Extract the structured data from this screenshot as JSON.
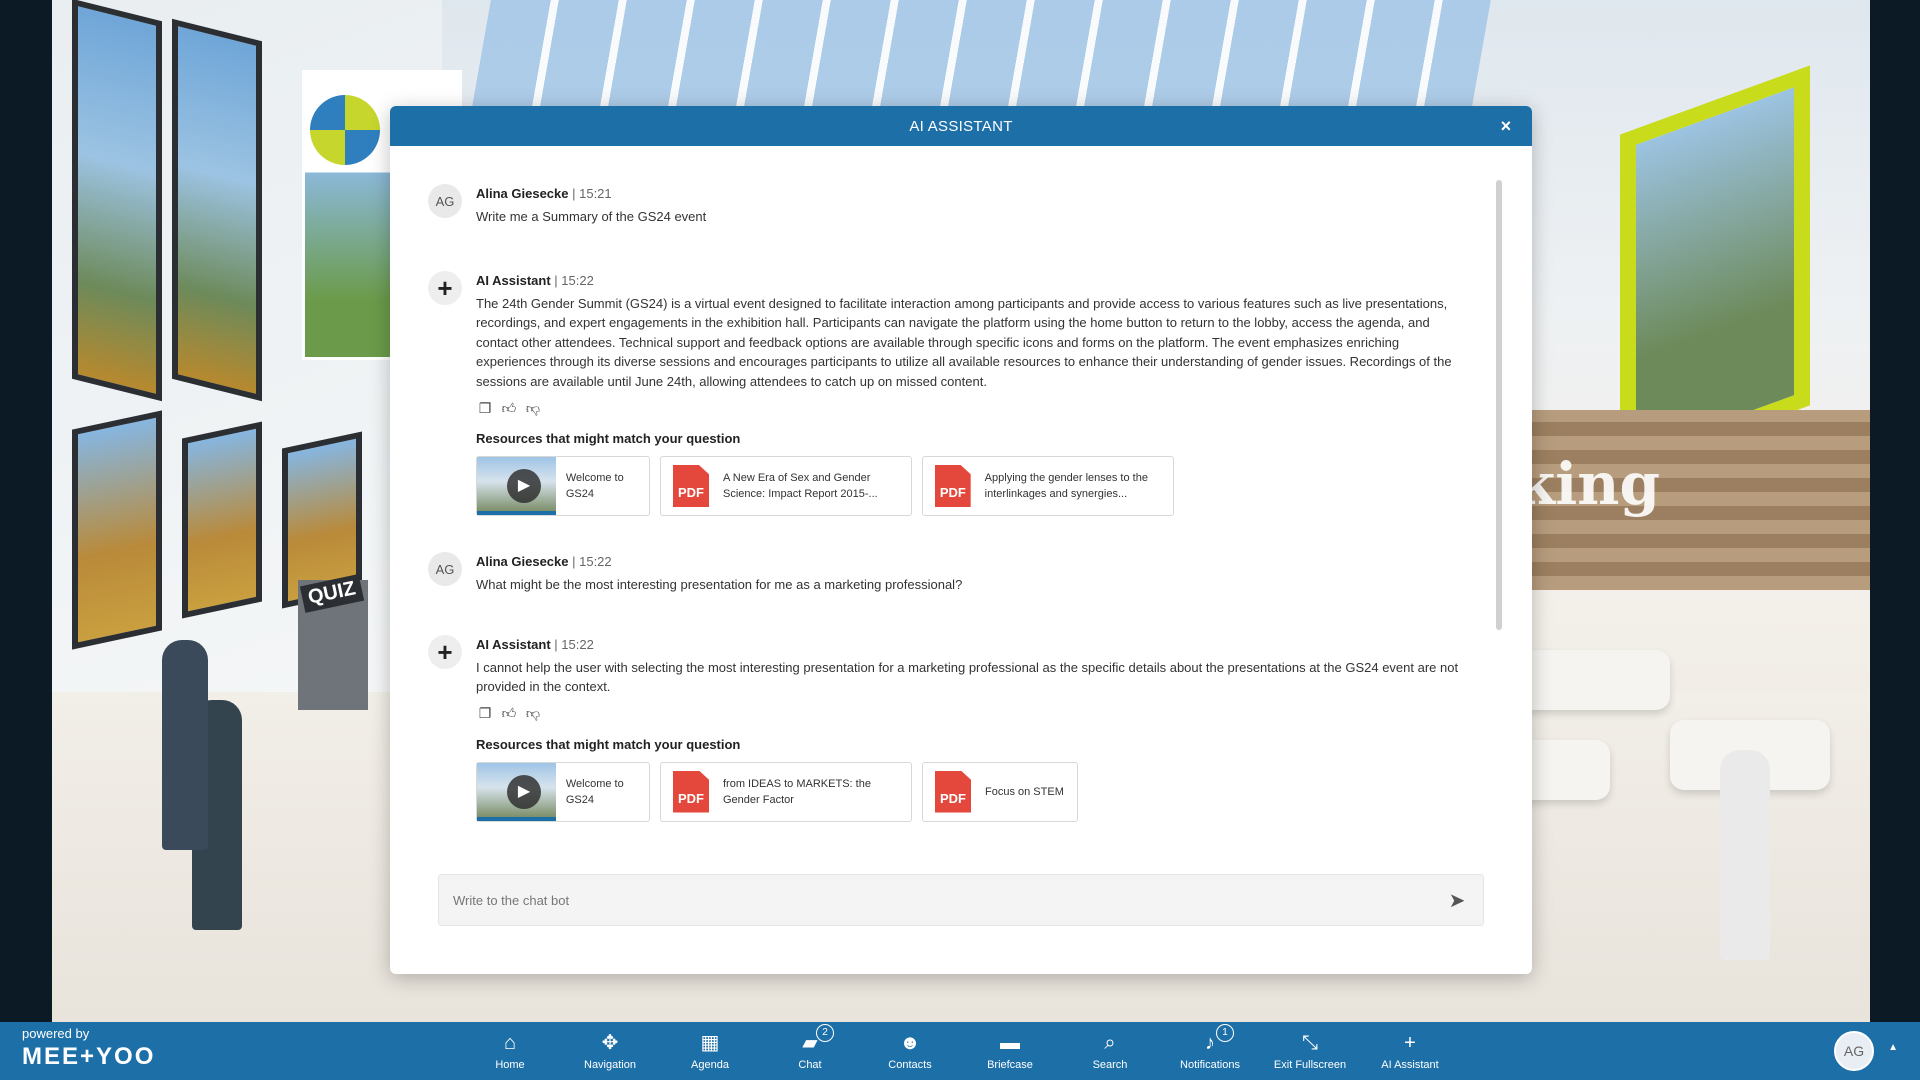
{
  "dialog": {
    "title": "AI ASSISTANT",
    "close_icon": "×",
    "input_placeholder": "Write to the chat bot"
  },
  "messages": [
    {
      "avatar": "AG",
      "name": "Alina Giesecke",
      "time": "| 15:21",
      "text": "Write me a Summary of the GS24 event"
    },
    {
      "avatar": "+",
      "name": "AI Assistant",
      "time": "| 15:22",
      "text": "The 24th Gender Summit (GS24) is a virtual event designed to facilitate interaction among participants and provide access to various features such as live presentations, recordings, and expert engagements in the exhibition hall. Participants can navigate the platform using the home button to return to the lobby, access the agenda, and contact other attendees. Technical support and feedback options are available through specific icons and forms on the platform. The event emphasizes enriching experiences through its diverse sessions and encourages participants to utilize all available resources to enhance their understanding of gender issues. Recordings of the sessions are available until June 24th, allowing attendees to catch up on missed content.",
      "resources_title": "Resources that might match your question",
      "resources": [
        {
          "type": "video",
          "label": "Welcome to GS24"
        },
        {
          "type": "pdf",
          "label": "A New Era of Sex and Gender Science: Impact Report 2015-..."
        },
        {
          "type": "pdf",
          "label": "Applying the gender lenses to the interlinkages and synergies..."
        }
      ]
    },
    {
      "avatar": "AG",
      "name": "Alina Giesecke",
      "time": "| 15:22",
      "text": "What might be the most interesting presentation for me as a marketing professional?"
    },
    {
      "avatar": "+",
      "name": "AI Assistant",
      "time": "| 15:22",
      "text": "I cannot help the user with selecting the most interesting presentation for a marketing professional as the specific details about the presentations at the GS24 event are not provided in the context.",
      "resources_title": "Resources that might match your question",
      "resources": [
        {
          "type": "video",
          "label": "Welcome to GS24"
        },
        {
          "type": "pdf",
          "label": "from IDEAS to MARKETS: the Gender Factor"
        },
        {
          "type": "pdf",
          "label": "Focus on STEM"
        }
      ]
    }
  ],
  "pdf_text": "PDF",
  "brand": {
    "powered": "powered by",
    "logo": "MEE+YOO"
  },
  "nav": [
    {
      "label": "Home",
      "icon": "home-icon",
      "glyph": "⌂"
    },
    {
      "label": "Navigation",
      "icon": "navigation-icon",
      "glyph": "✥"
    },
    {
      "label": "Agenda",
      "icon": "calendar-icon",
      "glyph": "▦"
    },
    {
      "label": "Chat",
      "icon": "chat-icon",
      "glyph": "▰",
      "badge": "2"
    },
    {
      "label": "Contacts",
      "icon": "contacts-icon",
      "glyph": "☻"
    },
    {
      "label": "Briefcase",
      "icon": "briefcase-icon",
      "glyph": "▬"
    },
    {
      "label": "Search",
      "icon": "search-icon",
      "glyph": "⌕"
    },
    {
      "label": "Notifications",
      "icon": "bell-icon",
      "glyph": "♪",
      "badge": "1"
    },
    {
      "label": "Exit Fullscreen",
      "icon": "exit-fullscreen-icon",
      "glyph": "⤡"
    },
    {
      "label": "AI Assistant",
      "icon": "ai-assistant-icon",
      "glyph": "+"
    }
  ],
  "user": {
    "initials": "AG"
  },
  "scene": {
    "quiz": "QUIZ",
    "wall_text": "orking"
  },
  "colors": {
    "primary": "#1d6fa8",
    "pdf": "#e4473b",
    "accent": "#c8dc1c"
  }
}
